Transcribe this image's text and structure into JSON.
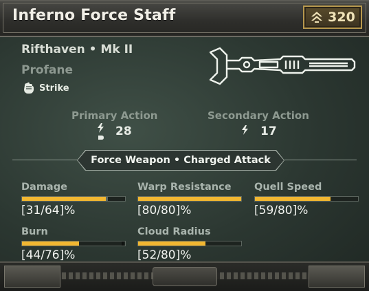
{
  "weapon": {
    "name": "Inferno Force Staff",
    "mastery_value": "320",
    "origin": "Rifthaven • Mk II",
    "variant": "Profane",
    "attack_type": "Strike",
    "icons": {
      "mastery": "chevron-rank-icon",
      "attack": "fist-icon",
      "weapon": "force-staff-icon",
      "primary": "lightning-bolt-icon",
      "primary_ammo": "ammo-pip-icon",
      "secondary": "lightning-bolt-icon"
    }
  },
  "actions": {
    "primary_label": "Primary Action",
    "primary_value": "28",
    "secondary_label": "Secondary Action",
    "secondary_value": "17"
  },
  "banner": {
    "label": "Force Weapon • Charged Attack"
  },
  "stats": [
    {
      "name": "Damage",
      "value_text": "[31/64]%",
      "fraction": 0.81
    },
    {
      "name": "Warp Resistance",
      "value_text": "[80/80]%",
      "fraction": 1.0
    },
    {
      "name": "Quell Speed",
      "value_text": "[59/80]%",
      "fraction": 0.73
    },
    {
      "name": "Burn",
      "value_text": "[44/76]%",
      "fraction": 0.55
    },
    {
      "name": "Cloud Radius",
      "value_text": "[52/80]%",
      "fraction": 0.65
    }
  ],
  "colors": {
    "bar_fill": "#f2b731",
    "mastery_border": "#b7984e",
    "title": "#f1efe7",
    "muted_text": "#8e9a91"
  }
}
